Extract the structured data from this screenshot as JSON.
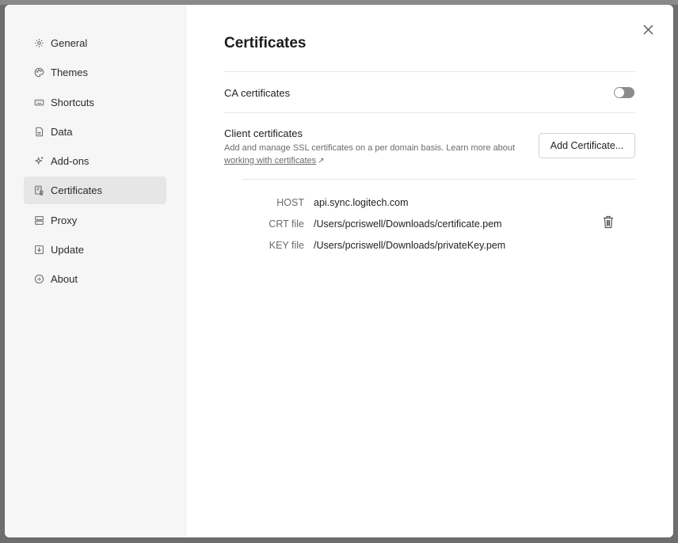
{
  "sidebar": {
    "items": [
      {
        "label": "General",
        "icon": "gear-icon"
      },
      {
        "label": "Themes",
        "icon": "palette-icon"
      },
      {
        "label": "Shortcuts",
        "icon": "keyboard-icon"
      },
      {
        "label": "Data",
        "icon": "database-icon"
      },
      {
        "label": "Add-ons",
        "icon": "sparkle-icon"
      },
      {
        "label": "Certificates",
        "icon": "certificate-icon",
        "active": true
      },
      {
        "label": "Proxy",
        "icon": "proxy-icon"
      },
      {
        "label": "Update",
        "icon": "download-icon"
      },
      {
        "label": "About",
        "icon": "info-icon"
      }
    ]
  },
  "page": {
    "title": "Certificates",
    "ca_label": "CA certificates",
    "ca_enabled": false,
    "client_title": "Client certificates",
    "client_desc": "Add and manage SSL certificates on a per domain basis. Learn more about ",
    "client_link": "working with certificates",
    "client_link_arrow": "↗",
    "add_button": "Add Certificate...",
    "certificate": {
      "host_label": "HOST",
      "host_value": "api.sync.logitech.com",
      "crt_label": "CRT file",
      "crt_value": "/Users/pcriswell/Downloads/certificate.pem",
      "key_label": "KEY file",
      "key_value": "/Users/pcriswell/Downloads/privateKey.pem"
    }
  },
  "colors": {
    "sidebar_bg": "#f6f6f6",
    "active_item_bg": "#e6e6e6",
    "toggle_off": "#8c8c8c"
  }
}
